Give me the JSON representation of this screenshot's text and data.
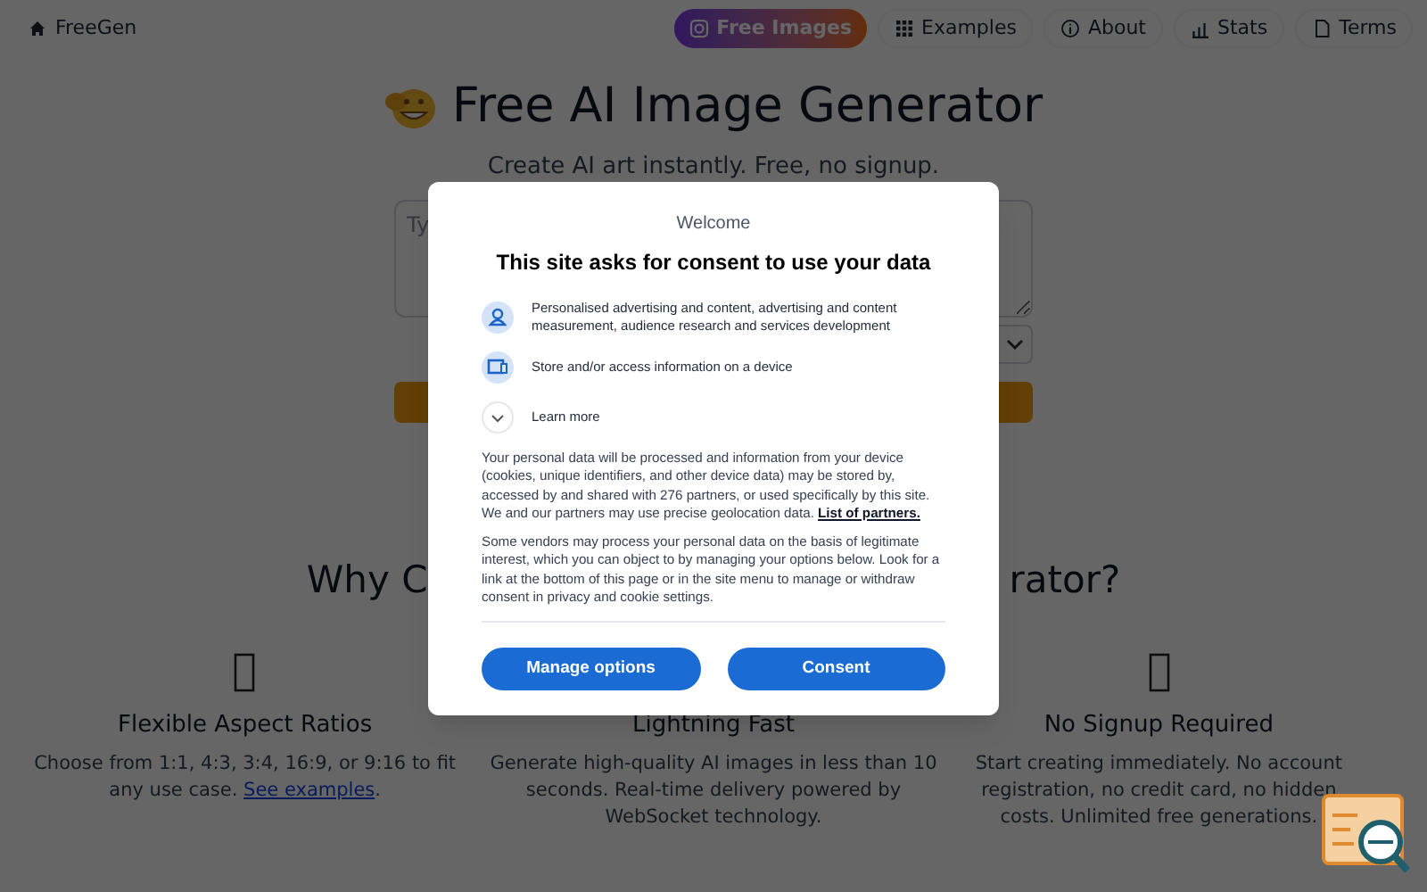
{
  "nav": {
    "brand": "FreeGen",
    "links": [
      {
        "label": "Free Images",
        "kind": "featured"
      },
      {
        "label": "Examples",
        "kind": "normal"
      },
      {
        "label": "About",
        "kind": "normal"
      },
      {
        "label": "Stats",
        "kind": "normal"
      },
      {
        "label": "Terms",
        "kind": "normal"
      }
    ]
  },
  "hero": {
    "title": "Free AI Image Generator",
    "subtitle": "Create AI art instantly. Free, no signup.",
    "prompt_placeholder": "Ty"
  },
  "why_heading": {
    "left": "Why C",
    "right": "rator?"
  },
  "features": [
    {
      "title": "Flexible Aspect Ratios",
      "description": "Choose from 1:1, 4:3, 3:4, 16:9, or 9:16 to fit any use case. ",
      "link": "See examples",
      "after": ".",
      "icon_visible": true
    },
    {
      "title": "Lightning Fast",
      "description": "Generate high-quality AI images in less than 10 seconds. Real-time delivery powered by WebSocket technology.",
      "icon_visible": false
    },
    {
      "title": "No Signup Required",
      "description": "Start creating immediately. No account registration, no credit card, no hidden costs. Unlimited free generations.",
      "icon_visible": true
    }
  ],
  "consent": {
    "eyebrow": "Welcome",
    "title": "This site asks for consent to use your data",
    "purposes": [
      {
        "kind": "person",
        "text": "Personalised advertising and content, advertising and content measurement, audience research and services development"
      },
      {
        "kind": "device",
        "text": "Store and/or access information on a device"
      },
      {
        "kind": "expand",
        "text": "Learn more"
      }
    ],
    "paragraph_1": "Your personal data will be processed and information from your device (cookies, unique identifiers, and other device data) may be stored by, accessed by and shared with 276 partners, or used specifically by this site. We and our partners may use precise geolocation data. ",
    "partners_link": "List of partners.",
    "paragraph_2": "Some vendors may process your personal data on the basis of legitimate interest, which you can object to by managing your options below. Look for a link at the bottom of this page or in the site menu to manage or withdraw consent in privacy and cookie settings.",
    "buttons": [
      "Manage options",
      "Consent"
    ]
  }
}
